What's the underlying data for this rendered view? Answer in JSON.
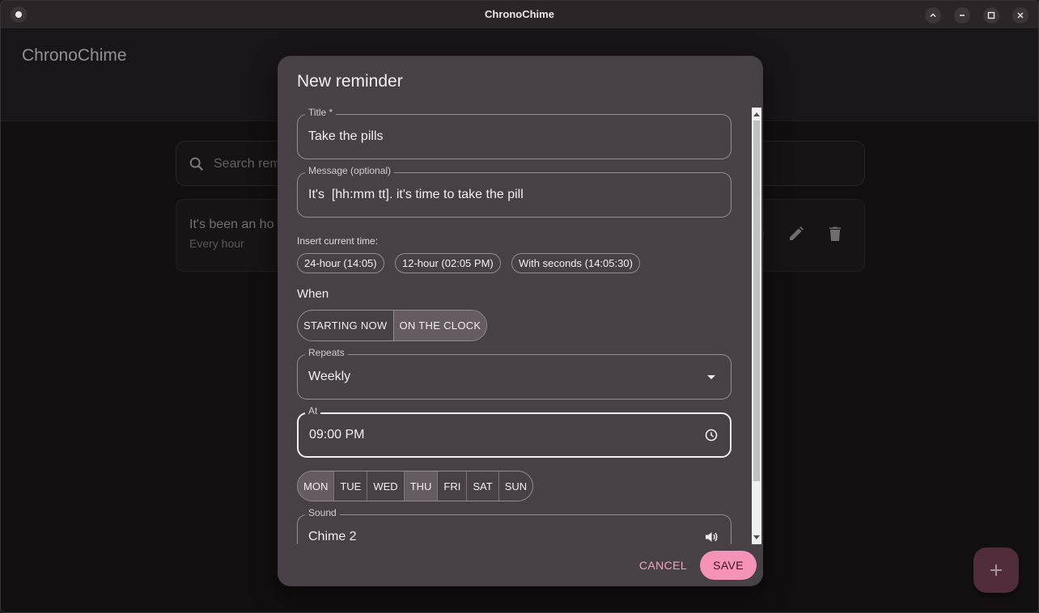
{
  "window": {
    "title": "ChronoChime"
  },
  "app": {
    "brand": "ChronoChime",
    "search": {
      "placeholder": "Search rem"
    },
    "reminder_card": {
      "title": "It's been an ho",
      "subtitle": "Every hour"
    }
  },
  "dialog": {
    "title": "New reminder",
    "title_field": {
      "label": "Title *",
      "value": "Take the pills"
    },
    "message_field": {
      "label": "Message (optional)",
      "value": "It's  [hh:mm tt]. it's time to take the pill"
    },
    "insert_time": {
      "label": "Insert current time:",
      "chips": [
        "24-hour (14:05)",
        "12-hour (02:05 PM)",
        "With seconds (14:05:30)"
      ]
    },
    "when": {
      "label": "When",
      "options": [
        "STARTING NOW",
        "ON THE CLOCK"
      ],
      "selected": "ON THE CLOCK"
    },
    "repeats": {
      "label": "Repeats",
      "value": "Weekly"
    },
    "at": {
      "label": "At",
      "value": "09:00 PM"
    },
    "days": {
      "items": [
        "MON",
        "TUE",
        "WED",
        "THU",
        "FRI",
        "SAT",
        "SUN"
      ],
      "selected": [
        "MON",
        "THU"
      ]
    },
    "sound": {
      "label": "Sound",
      "value": "Chime 2"
    },
    "cancel_label": "CANCEL",
    "save_label": "SAVE"
  },
  "colors": {
    "accent": "#f592b8",
    "surface": "#474045",
    "background": "#1a1517"
  }
}
